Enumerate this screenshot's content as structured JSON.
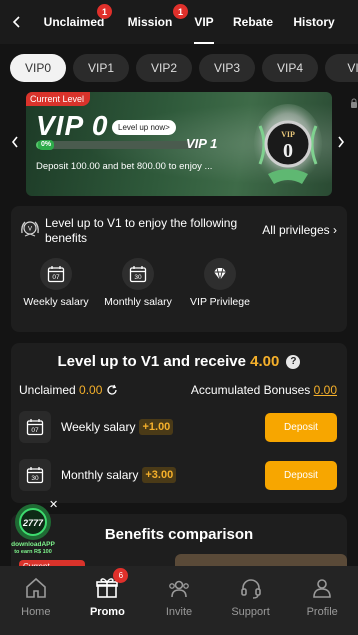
{
  "topnav": {
    "tabs": [
      {
        "label": "Unclaimed",
        "badge": "1"
      },
      {
        "label": "Mission",
        "badge": "1"
      },
      {
        "label": "VIP",
        "badge": ""
      },
      {
        "label": "Rebate",
        "badge": ""
      },
      {
        "label": "History",
        "badge": ""
      }
    ],
    "active_tab": "VIP"
  },
  "vip_levels": [
    "VIP0",
    "VIP1",
    "VIP2",
    "VIP3",
    "VIP4",
    "VI"
  ],
  "banner": {
    "current_level_tag": "Current Level",
    "vip_title": "VIP 0",
    "level_up_button": "Level up now>",
    "progress_percent": "0%",
    "progress_value": 0,
    "next_vip": "VIP 1",
    "deposit_text": "Deposit 100.00 and bet 800.00 to enjoy ...",
    "medal_top": "VIP",
    "medal_number": "0",
    "colors": {
      "tag": "#d9332b",
      "progress": "#56c26a"
    }
  },
  "privileges": {
    "title": "Level up to V1 to enjoy the following benefits",
    "all_link": "All privileges",
    "items": [
      {
        "label": "Weekly salary",
        "icon": "calendar-07-icon",
        "day": "07"
      },
      {
        "label": "Monthly salary",
        "icon": "calendar-30-icon",
        "day": "30"
      },
      {
        "label": "VIP Privilege",
        "icon": "diamond-icon"
      }
    ]
  },
  "levelup": {
    "title_prefix": "Level up to V1 and receive",
    "title_amount": "4.00",
    "unclaimed_label": "Unclaimed",
    "unclaimed_value": "0.00",
    "accumulated_label": "Accumulated Bonuses",
    "accumulated_value": "0.00",
    "rows": [
      {
        "name": "Weekly salary",
        "bonus": "+1.00",
        "button": "Deposit",
        "day": "07"
      },
      {
        "name": "Monthly salary",
        "bonus": "+3.00",
        "button": "Deposit",
        "day": "30"
      }
    ],
    "accent": "#f5b02b"
  },
  "float_download": {
    "line1": "downloadAPP",
    "line2": "to earn R$ 100"
  },
  "benefits": {
    "title": "Benefits comparison",
    "current_tag": "Current"
  },
  "bottomnav": [
    {
      "label": "Home",
      "icon": "home-icon",
      "badge": ""
    },
    {
      "label": "Promo",
      "icon": "gift-icon",
      "badge": "6"
    },
    {
      "label": "Invite",
      "icon": "invite-icon",
      "badge": ""
    },
    {
      "label": "Support",
      "icon": "headset-icon",
      "badge": ""
    },
    {
      "label": "Profile",
      "icon": "profile-icon",
      "badge": ""
    }
  ],
  "bottomnav_active": "Promo"
}
